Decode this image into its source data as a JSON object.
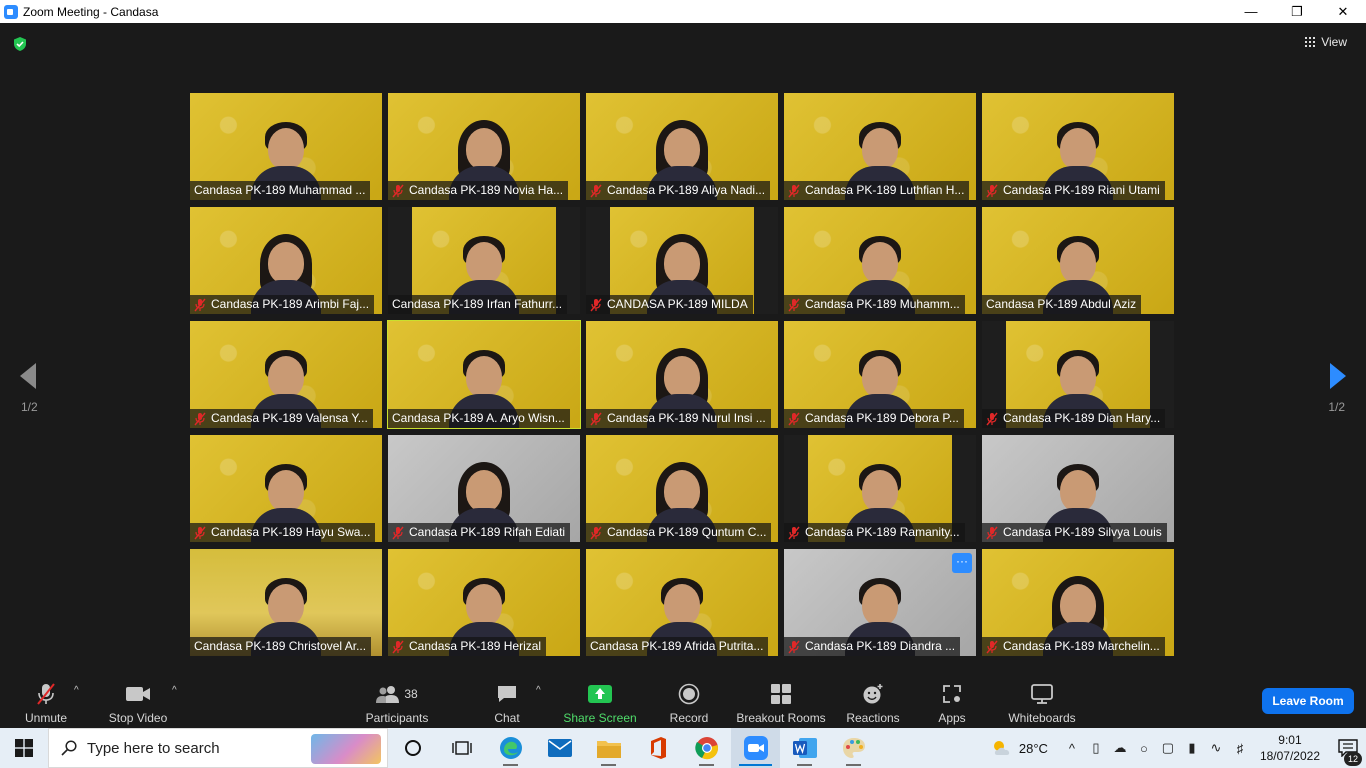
{
  "window": {
    "title": "Zoom Meeting - Candasa"
  },
  "header": {
    "view_label": "View"
  },
  "pagination": {
    "left": "1/2",
    "right": "1/2"
  },
  "participants": [
    {
      "name": "Candasa PK-189 Muhammad ...",
      "muted": false
    },
    {
      "name": "Candasa PK-189 Novia Ha...",
      "muted": true
    },
    {
      "name": "Candasa PK-189 Aliya Nadi...",
      "muted": true
    },
    {
      "name": "Candasa PK-189 Luthfian H...",
      "muted": true
    },
    {
      "name": "Candasa PK-189 Riani Utami",
      "muted": true
    },
    {
      "name": "Candasa PK-189 Arimbi Faj...",
      "muted": true
    },
    {
      "name": "Candasa PK-189 Irfan Fathurr...",
      "muted": false
    },
    {
      "name": "CANDASA PK-189 MILDA",
      "muted": true
    },
    {
      "name": "Candasa PK-189 Muhamm...",
      "muted": true
    },
    {
      "name": "Candasa PK-189 Abdul Aziz",
      "muted": false
    },
    {
      "name": "Candasa PK-189 Valensa Y...",
      "muted": true
    },
    {
      "name": "Candasa PK-189 A. Aryo Wisn...",
      "muted": false
    },
    {
      "name": "Candasa PK-189 Nurul Insi ...",
      "muted": true
    },
    {
      "name": "Candasa PK-189 Debora P...",
      "muted": true
    },
    {
      "name": "Candasa PK-189 Dian Hary...",
      "muted": true
    },
    {
      "name": "Candasa PK-189 Hayu Swa...",
      "muted": true
    },
    {
      "name": "Candasa PK-189 Rifah Ediati",
      "muted": true
    },
    {
      "name": "Candasa PK-189 Quntum C...",
      "muted": true
    },
    {
      "name": "Candasa PK-189 Ramanity...",
      "muted": true
    },
    {
      "name": "Candasa PK-189 Silvya Louis",
      "muted": true
    },
    {
      "name": "Candasa PK-189 Christovel Ar...",
      "muted": false
    },
    {
      "name": "Candasa PK-189 Herizal",
      "muted": true
    },
    {
      "name": "Candasa PK-189 Afrida Putrita...",
      "muted": false
    },
    {
      "name": "Candasa PK-189 Diandra ...",
      "muted": true
    },
    {
      "name": "Candasa PK-189 Marchelin...",
      "muted": true
    }
  ],
  "tile_more_label": "···",
  "toolbar": {
    "unmute": "Unmute",
    "stop_video": "Stop Video",
    "participants": "Participants",
    "participant_count": "38",
    "chat": "Chat",
    "share_screen": "Share Screen",
    "record": "Record",
    "breakout_rooms": "Breakout Rooms",
    "reactions": "Reactions",
    "apps": "Apps",
    "whiteboards": "Whiteboards",
    "leave_room": "Leave Room"
  },
  "taskbar": {
    "search_placeholder": "Type here to search",
    "temperature": "28°C",
    "time": "9:01",
    "date": "18/07/2022",
    "notification_count": "12"
  },
  "colors": {
    "zoom_blue": "#2d8cff",
    "share_green": "#4fdc6a",
    "mute_red": "#e02828",
    "leave_blue": "#0e72ed",
    "active_speaker": "#c9e02e"
  }
}
